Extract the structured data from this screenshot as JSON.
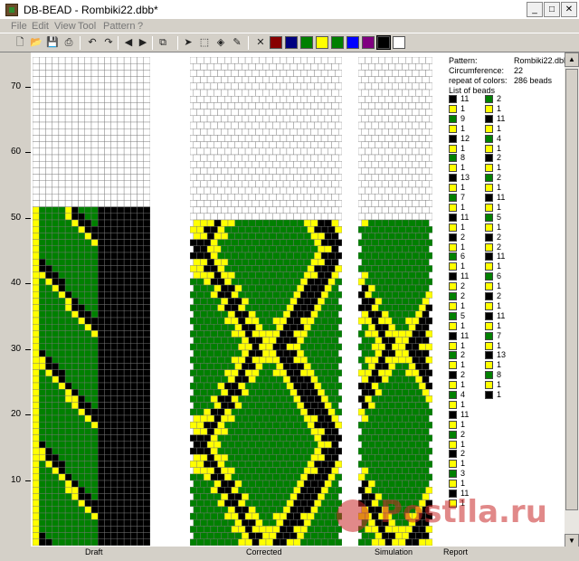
{
  "window": {
    "title": "DB-BEAD - Rombiki22.dbb*",
    "controls": [
      "minimize",
      "maximize",
      "close"
    ]
  },
  "menu": [
    "File",
    "Edit",
    "View",
    "Tool",
    "Pattern",
    "?"
  ],
  "toolbar": {
    "buttons": [
      "new-icon",
      "open-icon",
      "save-icon",
      "print-icon",
      "undo-icon",
      "redo-icon",
      "arrow-left-icon",
      "arrow-right-icon",
      "copy-icon",
      "pointer-icon",
      "select-icon",
      "fill-icon",
      "pipette-icon"
    ],
    "palette": [
      "#880000",
      "#000080",
      "#008000",
      "#ffff00",
      "#008000",
      "#0000ff",
      "#800080",
      "#000000",
      "#ffffff"
    ],
    "palette_selected": 7
  },
  "axis": {
    "labels": [
      "70",
      "60",
      "50",
      "40",
      "30",
      "20",
      "10"
    ],
    "values": [
      70,
      60,
      50,
      40,
      30,
      20,
      10
    ]
  },
  "views": {
    "draft_label": "Draft",
    "corrected_label": "Corrected",
    "simulation_label": "Simulation",
    "report_label": "Report"
  },
  "report": {
    "pattern_label": "Pattern:",
    "pattern_value": "Rombiki22.dbb",
    "circumference_label": "Circumference:",
    "circumference_value": "22",
    "repeat_label": "repeat of colors:",
    "repeat_value": "286 beads",
    "list_label": "List of beads"
  },
  "bead_list": {
    "column1": [
      {
        "color": "#000000",
        "count": "11"
      },
      {
        "color": "#ffff00",
        "count": "1"
      },
      {
        "color": "#008000",
        "count": "9"
      },
      {
        "color": "#ffff00",
        "count": "1"
      },
      {
        "color": "#000000",
        "count": "12"
      },
      {
        "color": "#ffff00",
        "count": "1"
      },
      {
        "color": "#008000",
        "count": "8"
      },
      {
        "color": "#ffff00",
        "count": "1"
      },
      {
        "color": "#000000",
        "count": "13"
      },
      {
        "color": "#ffff00",
        "count": "1"
      },
      {
        "color": "#008000",
        "count": "7"
      },
      {
        "color": "#ffff00",
        "count": "1"
      },
      {
        "color": "#000000",
        "count": "11"
      },
      {
        "color": "#ffff00",
        "count": "1"
      },
      {
        "color": "#000000",
        "count": "2"
      },
      {
        "color": "#ffff00",
        "count": "1"
      },
      {
        "color": "#008000",
        "count": "6"
      },
      {
        "color": "#ffff00",
        "count": "1"
      },
      {
        "color": "#000000",
        "count": "11"
      },
      {
        "color": "#ffff00",
        "count": "2"
      },
      {
        "color": "#008000",
        "count": "2"
      },
      {
        "color": "#ffff00",
        "count": "1"
      },
      {
        "color": "#008000",
        "count": "5"
      },
      {
        "color": "#ffff00",
        "count": "1"
      },
      {
        "color": "#000000",
        "count": "11"
      },
      {
        "color": "#ffff00",
        "count": "1"
      },
      {
        "color": "#008000",
        "count": "2"
      },
      {
        "color": "#ffff00",
        "count": "1"
      },
      {
        "color": "#000000",
        "count": "2"
      },
      {
        "color": "#ffff00",
        "count": "1"
      },
      {
        "color": "#008000",
        "count": "4"
      },
      {
        "color": "#ffff00",
        "count": "1"
      },
      {
        "color": "#000000",
        "count": "11"
      },
      {
        "color": "#ffff00",
        "count": "1"
      },
      {
        "color": "#008000",
        "count": "2"
      },
      {
        "color": "#ffff00",
        "count": "1"
      },
      {
        "color": "#000000",
        "count": "2"
      },
      {
        "color": "#ffff00",
        "count": "1"
      },
      {
        "color": "#008000",
        "count": "3"
      },
      {
        "color": "#ffff00",
        "count": "1"
      },
      {
        "color": "#000000",
        "count": "11"
      },
      {
        "color": "#ffff00",
        "count": "1"
      }
    ],
    "column2": [
      {
        "color": "#008000",
        "count": "2"
      },
      {
        "color": "#ffff00",
        "count": "1"
      },
      {
        "color": "#000000",
        "count": "11"
      },
      {
        "color": "#ffff00",
        "count": "1"
      },
      {
        "color": "#008000",
        "count": "4"
      },
      {
        "color": "#ffff00",
        "count": "1"
      },
      {
        "color": "#000000",
        "count": "2"
      },
      {
        "color": "#ffff00",
        "count": "1"
      },
      {
        "color": "#008000",
        "count": "2"
      },
      {
        "color": "#ffff00",
        "count": "1"
      },
      {
        "color": "#000000",
        "count": "11"
      },
      {
        "color": "#ffff00",
        "count": "1"
      },
      {
        "color": "#008000",
        "count": "5"
      },
      {
        "color": "#ffff00",
        "count": "1"
      },
      {
        "color": "#000000",
        "count": "2"
      },
      {
        "color": "#ffff00",
        "count": "2"
      },
      {
        "color": "#000000",
        "count": "11"
      },
      {
        "color": "#ffff00",
        "count": "1"
      },
      {
        "color": "#008000",
        "count": "6"
      },
      {
        "color": "#ffff00",
        "count": "1"
      },
      {
        "color": "#000000",
        "count": "2"
      },
      {
        "color": "#ffff00",
        "count": "1"
      },
      {
        "color": "#000000",
        "count": "11"
      },
      {
        "color": "#ffff00",
        "count": "1"
      },
      {
        "color": "#008000",
        "count": "7"
      },
      {
        "color": "#ffff00",
        "count": "1"
      },
      {
        "color": "#000000",
        "count": "13"
      },
      {
        "color": "#ffff00",
        "count": "1"
      },
      {
        "color": "#008000",
        "count": "8"
      },
      {
        "color": "#ffff00",
        "count": "1"
      },
      {
        "color": "#000000",
        "count": "1"
      }
    ]
  },
  "watermark": "Postila.ru"
}
